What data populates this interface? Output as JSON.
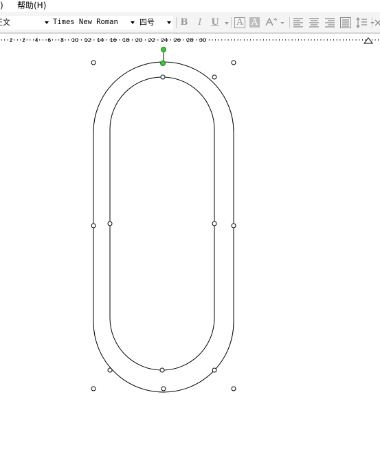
{
  "menubar": {
    "partial_item": ")",
    "help_label": "帮助(H)"
  },
  "toolbar": {
    "style_value": "正文",
    "font_value": "Times New Roman",
    "size_value": "四号",
    "buttons": {
      "bold": "B",
      "italic": "I",
      "underline": "U",
      "char_border": "A",
      "char_shading": "A"
    }
  },
  "ruler": {
    "labels": [
      "2",
      "2",
      "4",
      "6",
      "8",
      "10",
      "12",
      "14",
      "16",
      "18",
      "20",
      "22",
      "24",
      "26",
      "28",
      "30"
    ]
  },
  "colors": {
    "handle_fill": "#ffffff",
    "rotate_handle": "#33cc33",
    "shape_stroke": "#000000"
  },
  "icons": [
    "align-left-icon",
    "align-center-icon",
    "align-right-icon",
    "justify-icon",
    "line-spacing-icon",
    "text-effect-icon"
  ]
}
